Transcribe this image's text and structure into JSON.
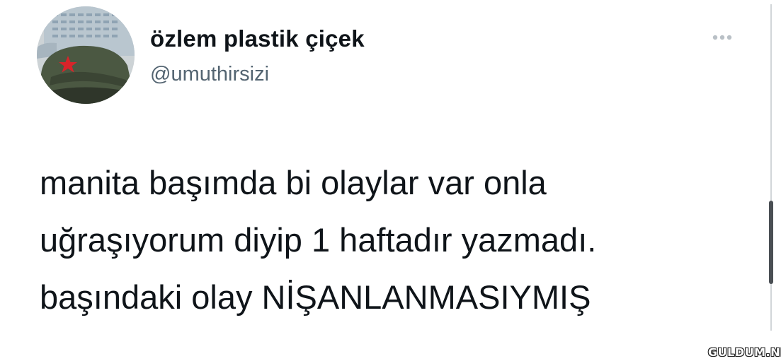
{
  "author": {
    "name": "özlem plastik çiçek",
    "handle": "@umuthirsizi",
    "avatar_icon": "avatar-cap-with-red-star"
  },
  "actions": {
    "more_icon": "more-dots-icon"
  },
  "tweet": {
    "lines": [
      "manita başımda bi olaylar var onla",
      "uğraşıyorum diyip 1 haftadır yazmadı.",
      "başındaki olay NİŞANLANMASIYMIŞ"
    ]
  },
  "watermark": {
    "text": "GULDUM.NET"
  },
  "colors": {
    "text_primary": "#0f1419",
    "text_secondary": "#536471",
    "star": "#d8242a"
  }
}
